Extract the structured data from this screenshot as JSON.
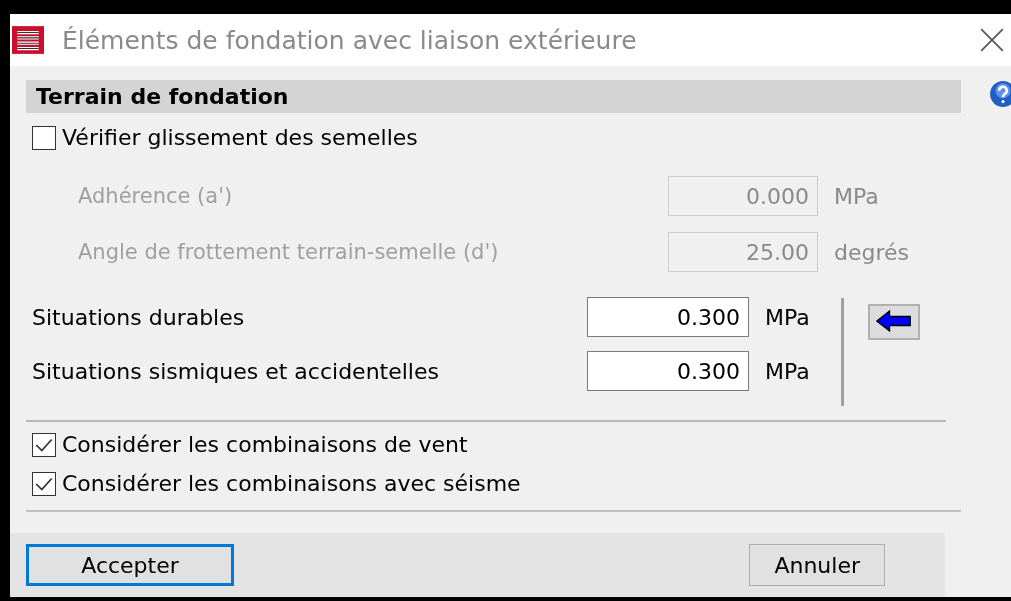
{
  "window": {
    "title": "Éléments de fondation avec liaison extérieure"
  },
  "section": {
    "title": "Terrain de fondation"
  },
  "slide_check": {
    "label": "Vérifier glissement des semelles",
    "checked": false
  },
  "friction_fields": [
    {
      "label": "Adhérence (a')",
      "value": "0.000",
      "unit": "MPa",
      "disabled": true
    },
    {
      "label": "Angle de frottement terrain-semelle (d')",
      "value": "25.00",
      "unit": "degrés",
      "disabled": true
    }
  ],
  "pressure_fields": [
    {
      "label": "Situations durables",
      "value": "0.300",
      "unit": "MPa",
      "disabled": false
    },
    {
      "label": "Situations sismiques et accidentelles",
      "value": "0.300",
      "unit": "MPa",
      "disabled": false
    }
  ],
  "options": [
    {
      "label": "Considérer les combinaisons de vent",
      "checked": true
    },
    {
      "label": "Considérer les combinaisons avec séisme",
      "checked": true
    }
  ],
  "buttons": [
    {
      "label": "Accepter",
      "default": true
    },
    {
      "label": "Annuler",
      "default": false
    }
  ]
}
